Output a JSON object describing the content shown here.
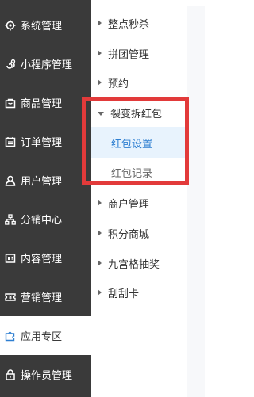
{
  "sidebar": {
    "items": [
      {
        "label": "系统管理",
        "icon": "gear-icon"
      },
      {
        "label": "小程序管理",
        "icon": "mini-program-icon"
      },
      {
        "label": "商品管理",
        "icon": "bag-icon"
      },
      {
        "label": "订单管理",
        "icon": "calendar-icon"
      },
      {
        "label": "用户管理",
        "icon": "user-icon"
      },
      {
        "label": "分销中心",
        "icon": "org-chart-icon"
      },
      {
        "label": "内容管理",
        "icon": "content-icon"
      },
      {
        "label": "营销管理",
        "icon": "ticket-icon"
      },
      {
        "label": "应用专区",
        "icon": "puzzle-icon",
        "active": true
      },
      {
        "label": "操作员管理",
        "icon": "lock-icon"
      }
    ]
  },
  "submenu": {
    "items": [
      {
        "label": "整点秒杀"
      },
      {
        "label": "拼团管理"
      },
      {
        "label": "预约"
      },
      {
        "label": "裂变拆红包",
        "expanded": true
      },
      {
        "label": "商户管理"
      },
      {
        "label": "积分商城"
      },
      {
        "label": "九宫格抽奖"
      },
      {
        "label": "刮刮卡"
      }
    ],
    "children": [
      {
        "label": "红包设置",
        "selected": true
      },
      {
        "label": "红包记录"
      }
    ]
  },
  "colors": {
    "sidebar_bg": "#3a3a3a",
    "selected_bg": "#e8f3fd",
    "selected_text": "#2e7fd1",
    "highlight_border": "#e23a3a"
  }
}
